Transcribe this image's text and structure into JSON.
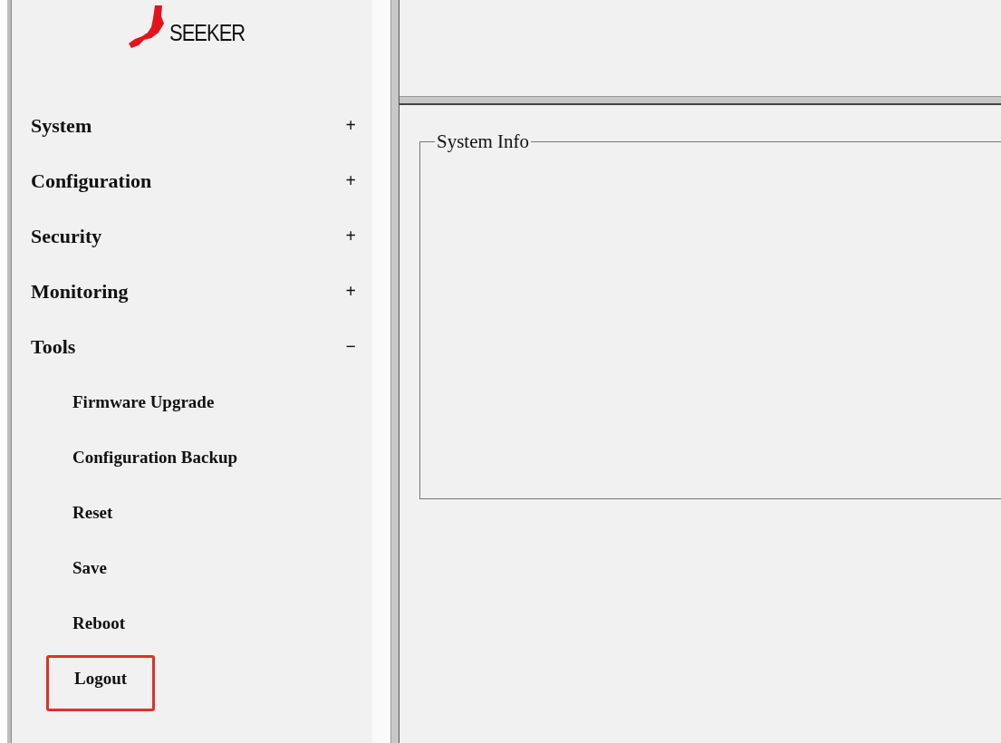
{
  "logo": {
    "text": "SEEKER"
  },
  "menu": [
    {
      "label": "System",
      "toggle": "+"
    },
    {
      "label": "Configuration",
      "toggle": "+"
    },
    {
      "label": "Security",
      "toggle": "+"
    },
    {
      "label": "Monitoring",
      "toggle": "+"
    },
    {
      "label": "Tools",
      "toggle": "−",
      "children": [
        {
          "label": "Firmware Upgrade",
          "highlighted": false
        },
        {
          "label": "Configuration Backup",
          "highlighted": false
        },
        {
          "label": "Reset",
          "highlighted": false
        },
        {
          "label": "Save",
          "highlighted": false
        },
        {
          "label": "Reboot",
          "highlighted": false
        },
        {
          "label": "Logout",
          "highlighted": true
        }
      ]
    }
  ],
  "panel": {
    "legend": "System Info"
  }
}
